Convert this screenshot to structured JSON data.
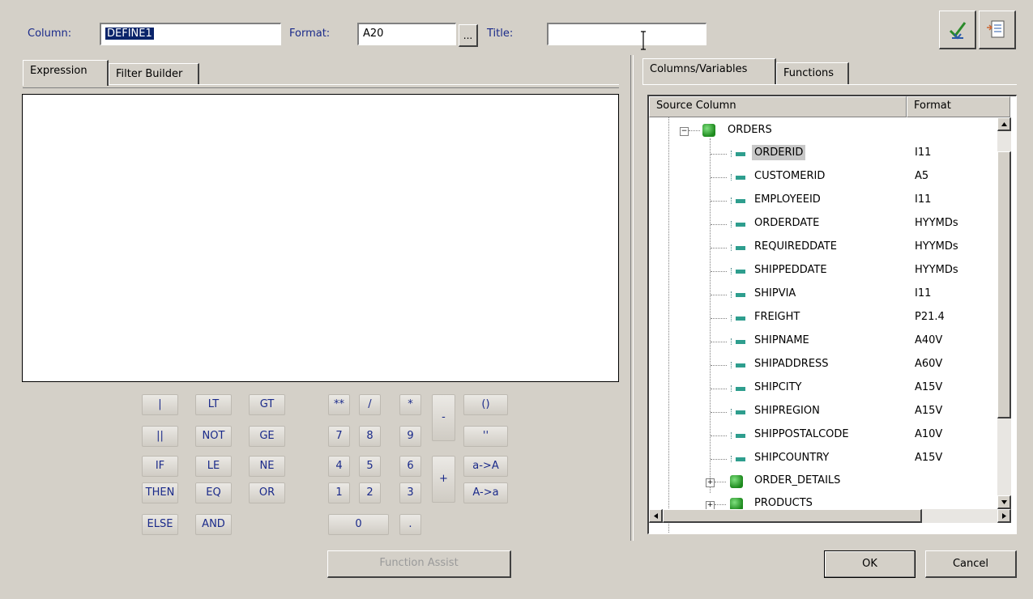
{
  "header": {
    "column_label": "Column:",
    "column_value": "DEFINE1",
    "format_label": "Format:",
    "format_value": "A20",
    "browse_label": "...",
    "title_label": "Title:",
    "title_value": ""
  },
  "left_tabs": [
    {
      "label": "Expression"
    },
    {
      "label": "Filter Builder"
    }
  ],
  "right_tabs": [
    {
      "label": "Columns/Variables"
    },
    {
      "label": "Functions"
    }
  ],
  "calculator": {
    "logic": [
      "|",
      "LT",
      "GT",
      "||",
      "NOT",
      "GE",
      "IF",
      "LE",
      "NE",
      "THEN",
      "EQ",
      "OR",
      "ELSE",
      "AND"
    ],
    "ops": [
      "**",
      "/",
      "*",
      "-",
      "()",
      "''",
      "+",
      "a->A",
      "A->a"
    ],
    "digits": [
      "7",
      "8",
      "9",
      "4",
      "5",
      "6",
      "1",
      "2",
      "3",
      "0",
      "."
    ]
  },
  "function_assist_label": "Function Assist",
  "tree": {
    "header_source": "Source Column",
    "header_format": "Format",
    "root": "ORDERS",
    "columns": [
      {
        "name": "ORDERID",
        "format": "I11"
      },
      {
        "name": "CUSTOMERID",
        "format": "A5"
      },
      {
        "name": "EMPLOYEEID",
        "format": "I11"
      },
      {
        "name": "ORDERDATE",
        "format": "HYYMDs"
      },
      {
        "name": "REQUIREDDATE",
        "format": "HYYMDs"
      },
      {
        "name": "SHIPPEDDATE",
        "format": "HYYMDs"
      },
      {
        "name": "SHIPVIA",
        "format": "I11"
      },
      {
        "name": "FREIGHT",
        "format": "P21.4"
      },
      {
        "name": "SHIPNAME",
        "format": "A40V"
      },
      {
        "name": "SHIPADDRESS",
        "format": "A60V"
      },
      {
        "name": "SHIPCITY",
        "format": "A15V"
      },
      {
        "name": "SHIPREGION",
        "format": "A15V"
      },
      {
        "name": "SHIPPOSTALCODE",
        "format": "A10V"
      },
      {
        "name": "SHIPCOUNTRY",
        "format": "A15V"
      }
    ],
    "siblings": [
      "ORDER_DETAILS",
      "PRODUCTS"
    ]
  },
  "buttons": {
    "ok": "OK",
    "cancel": "Cancel"
  },
  "colors": {
    "face": "#d4d0c8",
    "label": "#1a2a8a",
    "selection": "#0a246a"
  }
}
